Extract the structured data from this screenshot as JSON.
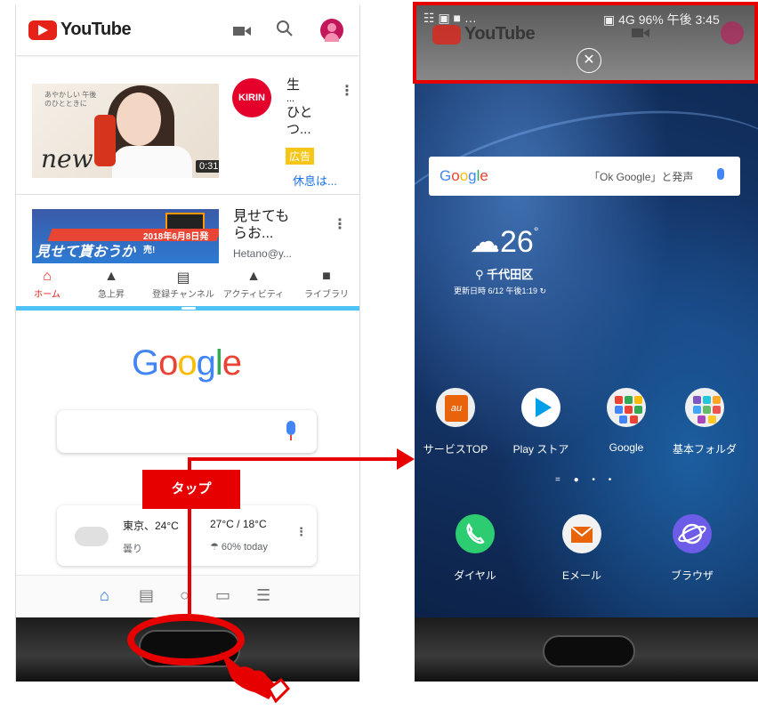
{
  "left": {
    "app_name": "YouTube",
    "video1": {
      "title_lines": [
        "生",
        "...",
        "ひと",
        "つ..."
      ],
      "ad_label": "広告",
      "link": "休息は...",
      "duration": "0:31",
      "channel_logo": "KIRIN",
      "thumb_script": "new",
      "thumb_small": "あやかしい 午後のひとときに"
    },
    "video2": {
      "title_lines": [
        "見せても",
        "らお..."
      ],
      "channel": "Hetano@y...",
      "thumb_text": "見せて貰おうか",
      "thumb_date": "2018年6月8日発売!"
    },
    "nav": [
      {
        "label": "ホーム",
        "icon": "home-icon"
      },
      {
        "label": "急上昇",
        "icon": "flame-icon"
      },
      {
        "label": "登録チャンネル",
        "icon": "subscriptions-icon"
      },
      {
        "label": "アクティビティ",
        "icon": "bell-icon"
      },
      {
        "label": "ライブラリ",
        "icon": "folder-icon"
      }
    ],
    "google_logo": "Google",
    "weather": {
      "city_temp": "東京、24°C",
      "condition": "曇り",
      "high_low": "27°C / 18°C",
      "rain": "60% today"
    }
  },
  "right": {
    "status_right": "96% 午後 3:45",
    "status_signal": "4G",
    "app_name": "YouTube",
    "search_hint": "「Ok Google」と発声",
    "google_label": "Google",
    "temp": "26",
    "location": "千代田区",
    "updated": "更新日時 6/12 午後1:19",
    "apps_row1": [
      {
        "label": "サービスTOP",
        "icon": "au-icon"
      },
      {
        "label": "Play ストア",
        "icon": "play-store-icon"
      },
      {
        "label": "Google",
        "icon": "google-folder-icon"
      },
      {
        "label": "基本フォルダ",
        "icon": "basic-folder-icon"
      }
    ],
    "apps_row2": [
      {
        "label": "ダイヤル",
        "icon": "phone-icon"
      },
      {
        "label": "Eメール",
        "icon": "email-icon"
      },
      {
        "label": "ブラウザ",
        "icon": "browser-icon"
      }
    ],
    "au_text": "au"
  },
  "annotation": {
    "tap_label": "タップ",
    "accent_color": "#e60000"
  }
}
